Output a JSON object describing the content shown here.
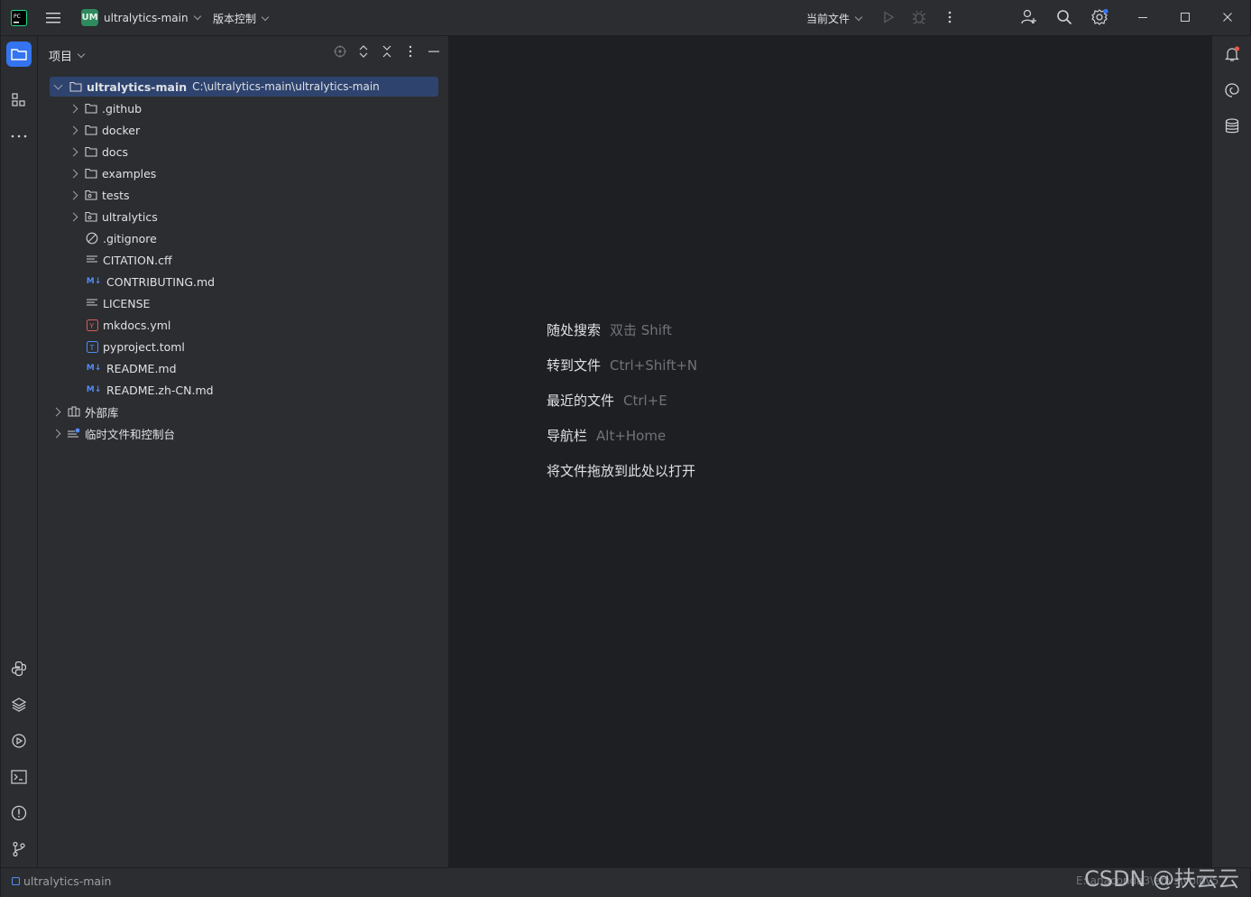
{
  "titlebar": {
    "project_badge": "UM",
    "project_name": "ultralytics-main",
    "vcs_menu": "版本控制",
    "run_config": "当前文件",
    "colors": {
      "badge": "#2f8a5d",
      "accent": "#3574f0",
      "notify_dot": "#e55b4c"
    }
  },
  "panel": {
    "title": "项目",
    "tree": [
      {
        "label": "ultralytics-main",
        "path": "C:\\ultralytics-main\\ultralytics-main",
        "type": "folder",
        "expanded": true,
        "level": 0,
        "selected": true
      },
      {
        "label": ".github",
        "type": "folder",
        "level": 1
      },
      {
        "label": "docker",
        "type": "folder",
        "level": 1
      },
      {
        "label": "docs",
        "type": "folder",
        "level": 1
      },
      {
        "label": "examples",
        "type": "folder",
        "level": 1
      },
      {
        "label": "tests",
        "type": "package",
        "level": 1
      },
      {
        "label": "ultralytics",
        "type": "package",
        "level": 1
      },
      {
        "label": ".gitignore",
        "type": "ignore",
        "level": 1,
        "leaf": true
      },
      {
        "label": "CITATION.cff",
        "type": "text",
        "level": 1,
        "leaf": true
      },
      {
        "label": "CONTRIBUTING.md",
        "type": "markdown",
        "level": 1,
        "leaf": true
      },
      {
        "label": "LICENSE",
        "type": "text",
        "level": 1,
        "leaf": true
      },
      {
        "label": "mkdocs.yml",
        "type": "yaml",
        "level": 1,
        "leaf": true
      },
      {
        "label": "pyproject.toml",
        "type": "toml",
        "level": 1,
        "leaf": true
      },
      {
        "label": "README.md",
        "type": "markdown",
        "level": 1,
        "leaf": true
      },
      {
        "label": "README.zh-CN.md",
        "type": "markdown",
        "level": 1,
        "leaf": true
      },
      {
        "label": "外部库",
        "type": "library",
        "level": 0
      },
      {
        "label": "临时文件和控制台",
        "type": "scratch",
        "level": 0
      }
    ]
  },
  "editor": {
    "hints": [
      {
        "label": "随处搜索",
        "key": "双击 Shift"
      },
      {
        "label": "转到文件",
        "key": "Ctrl+Shift+N"
      },
      {
        "label": "最近的文件",
        "key": "Ctrl+E"
      },
      {
        "label": "导航栏",
        "key": "Alt+Home"
      },
      {
        "label": "将文件拖放到此处以打开",
        "key": ""
      }
    ]
  },
  "status": {
    "breadcrumb": "ultralytics-main",
    "right_path": "E:\\anaconda3\\envs\\yolov5"
  },
  "watermark": "CSDN @扶云云"
}
